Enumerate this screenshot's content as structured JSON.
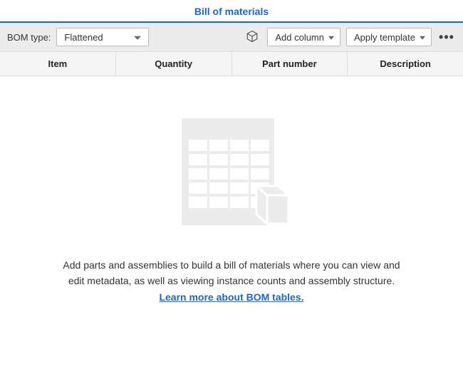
{
  "header": {
    "title": "Bill of materials"
  },
  "toolbar": {
    "bom_type_label": "BOM type:",
    "bom_type_value": "Flattened",
    "add_column_label": "Add column",
    "apply_template_label": "Apply template"
  },
  "columns": [
    "Item",
    "Quantity",
    "Part number",
    "Description"
  ],
  "empty_state": {
    "message": "Add parts and assemblies to build a bill of materials where you can view and edit metadata, as well as viewing instance counts and assembly structure. ",
    "learn_more": "Learn more about BOM tables."
  }
}
